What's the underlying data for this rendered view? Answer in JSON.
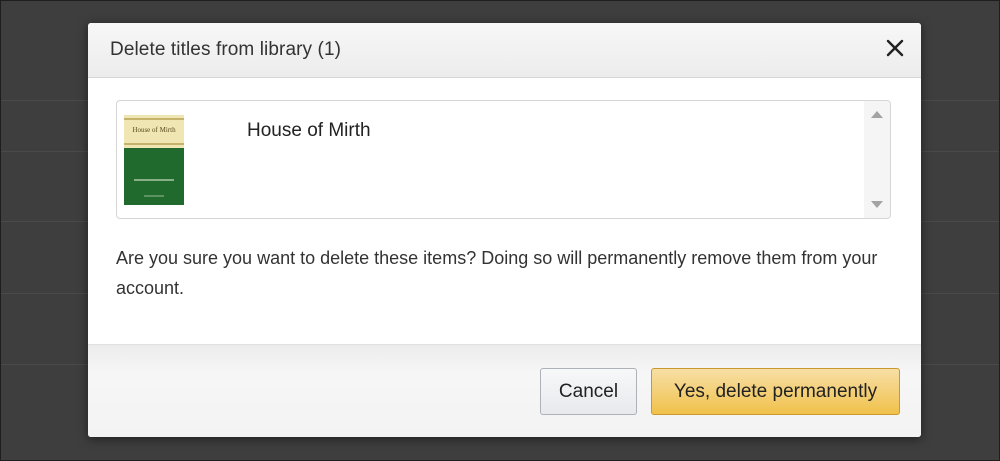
{
  "dialog": {
    "title": "Delete titles from library (1)",
    "close_icon": "close-icon"
  },
  "items": [
    {
      "title": "House of Mirth",
      "cover_title": "House of Mirth"
    }
  ],
  "message": "Are you sure you want to delete these items? Doing so will permanently remove them from your account.",
  "buttons": {
    "cancel": "Cancel",
    "confirm": "Yes, delete permanently"
  },
  "colors": {
    "overlay": "#3e3e3e",
    "confirm_button": "#f0c14b",
    "cover_green": "#1f6a2c",
    "cover_cream": "#efe6b3"
  }
}
